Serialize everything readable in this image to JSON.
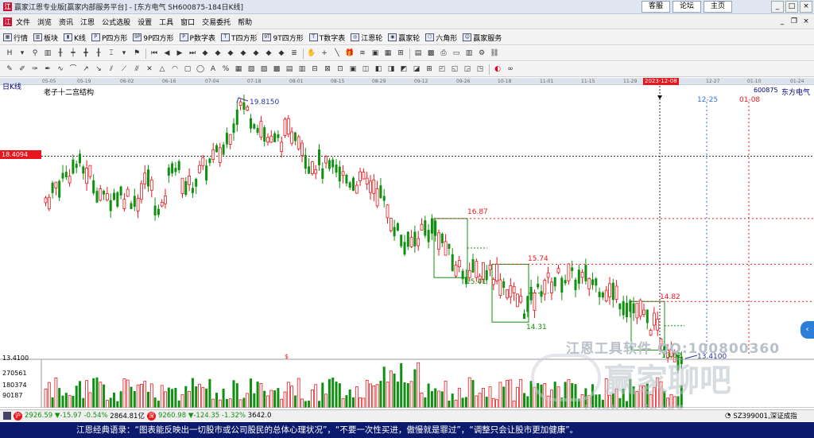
{
  "window": {
    "title": "赢家江恩专业版[赢家内部服务平台] - [东方电气  SH600875-184日K线]",
    "links": [
      "客服",
      "论坛",
      "主页"
    ],
    "controls": [
      "_",
      "□",
      "×"
    ]
  },
  "menu": {
    "items": [
      "文件",
      "浏览",
      "资讯",
      "江恩",
      "公式选股",
      "设置",
      "工具",
      "窗口",
      "交易委托",
      "帮助"
    ]
  },
  "toolbar": {
    "buttons": [
      "行情",
      "板块",
      "K线",
      "P四方形",
      "9P四方形",
      "P数字表",
      "T四方形",
      "9T四方形",
      "T数字表",
      "江恩轮",
      "赢家轮",
      "六角形",
      "赢家服务"
    ]
  },
  "dates": {
    "labels": [
      "05-05",
      "05-19",
      "06-02",
      "06-16",
      "07-04",
      "07-18",
      "08-01",
      "08-15",
      "08-29",
      "09-12",
      "09-26",
      "10-18",
      "11-01",
      "11-15",
      "11-29",
      "2023-12-08",
      "12-27",
      "01-10",
      "01-24"
    ]
  },
  "chart": {
    "period": "日K线",
    "structure": "老子十二宫结构",
    "code": "600875",
    "name": "东方电气",
    "current_price": "18.4094",
    "high_label": "19.8150",
    "low_label": "13.4100",
    "future_dates": [
      "12-25",
      "01-08"
    ],
    "box_labels": [
      "16.87",
      "15.41",
      "15.74",
      "14.31",
      "14.82",
      "13.62"
    ],
    "vol_marker": "$"
  },
  "volume": {
    "scale": [
      "13.4100",
      "270561",
      "180374",
      "90187"
    ]
  },
  "statusbar": {
    "sh_index": "2926.59",
    "sh_change": "▼-15.97",
    "sh_pct": "-0.54%",
    "sh_amount": "2864.81亿",
    "sz_index": "9260.98",
    "sz_change": "▼-124.35",
    "sz_pct": "-1.32%",
    "sz_amount": "3642.0",
    "right_text": "SZ399001,深证成指"
  },
  "watermark": {
    "line1": "江恩工具软件 QQ:100800360",
    "line2": "赢家聊吧",
    "line3": "liaoba.win168"
  },
  "quote": {
    "text": "江恩经典语录：“图表能反映出一切股市或公司股民的总体心理状况”，“不要一次性买进，傲慢就是罪过”，“调整只会让股市更加健康”。"
  },
  "chart_data": {
    "type": "candlestick",
    "title": "东方电气 600875 日K线",
    "yhigh": 19.815,
    "ylow": 13.41,
    "current": 18.4094,
    "boxes": [
      {
        "top": 16.87,
        "bottom": 15.41
      },
      {
        "top": 15.74,
        "bottom": 14.31
      },
      {
        "top": 14.82,
        "bottom": 13.62
      }
    ],
    "volume_scale": [
      90187,
      180374,
      270561
    ]
  }
}
